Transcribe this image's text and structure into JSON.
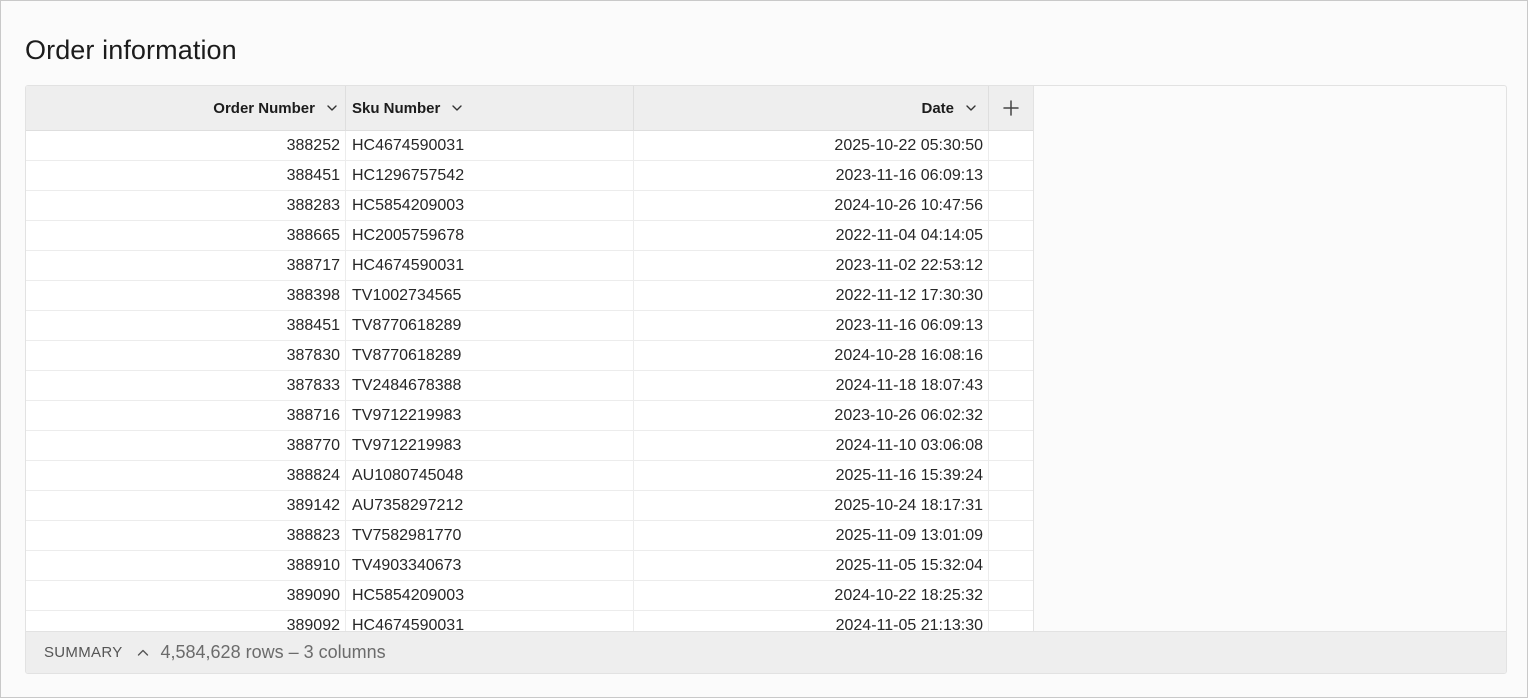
{
  "page": {
    "title": "Order information"
  },
  "table": {
    "columns": [
      {
        "label": "Order Number"
      },
      {
        "label": "Sku Number"
      },
      {
        "label": "Date"
      }
    ],
    "add_column_icon": "plus-icon",
    "sort_icon": "chevron-down-icon",
    "rows": [
      {
        "order": "388252",
        "sku": "HC4674590031",
        "date": "2025-10-22 05:30:50"
      },
      {
        "order": "388451",
        "sku": "HC1296757542",
        "date": "2023-11-16 06:09:13"
      },
      {
        "order": "388283",
        "sku": "HC5854209003",
        "date": "2024-10-26 10:47:56"
      },
      {
        "order": "388665",
        "sku": "HC2005759678",
        "date": "2022-11-04 04:14:05"
      },
      {
        "order": "388717",
        "sku": "HC4674590031",
        "date": "2023-11-02 22:53:12"
      },
      {
        "order": "388398",
        "sku": "TV1002734565",
        "date": "2022-11-12 17:30:30"
      },
      {
        "order": "388451",
        "sku": "TV8770618289",
        "date": "2023-11-16 06:09:13"
      },
      {
        "order": "387830",
        "sku": "TV8770618289",
        "date": "2024-10-28 16:08:16"
      },
      {
        "order": "387833",
        "sku": "TV2484678388",
        "date": "2024-11-18 18:07:43"
      },
      {
        "order": "388716",
        "sku": "TV9712219983",
        "date": "2023-10-26 06:02:32"
      },
      {
        "order": "388770",
        "sku": "TV9712219983",
        "date": "2024-11-10 03:06:08"
      },
      {
        "order": "388824",
        "sku": "AU1080745048",
        "date": "2025-11-16 15:39:24"
      },
      {
        "order": "389142",
        "sku": "AU7358297212",
        "date": "2025-10-24 18:17:31"
      },
      {
        "order": "388823",
        "sku": "TV7582981770",
        "date": "2025-11-09 13:01:09"
      },
      {
        "order": "388910",
        "sku": "TV4903340673",
        "date": "2025-11-05 15:32:04"
      },
      {
        "order": "389090",
        "sku": "HC5854209003",
        "date": "2024-10-22 18:25:32"
      },
      {
        "order": "389092",
        "sku": "HC4674590031",
        "date": "2024-11-05 21:13:30"
      }
    ]
  },
  "summary": {
    "label": "SUMMARY",
    "toggle_icon": "chevron-up-icon",
    "count_text": "4,584,628 rows – 3 columns"
  }
}
